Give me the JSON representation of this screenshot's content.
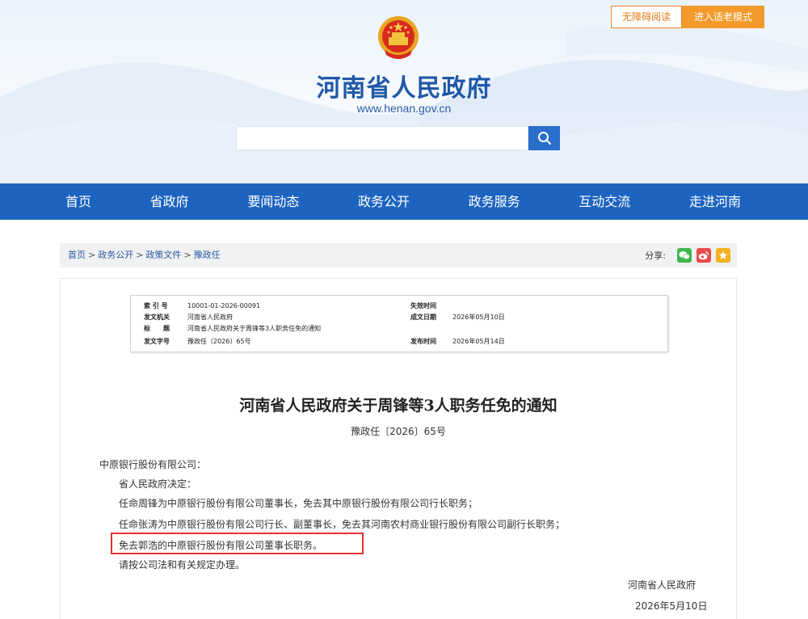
{
  "header": {
    "accessible_label": "无障碍阅读",
    "elder_mode_label": "进入适老模式",
    "site_name": "河南省人民政府",
    "site_url": "www.henan.gov.cn",
    "search_placeholder": ""
  },
  "nav": {
    "items": [
      "首页",
      "省政府",
      "要闻动态",
      "政务公开",
      "政务服务",
      "互动交流",
      "走进河南"
    ]
  },
  "breadcrumb": {
    "items": [
      "首页",
      "政务公开",
      "政策文件",
      "豫政任"
    ],
    "separator": ">"
  },
  "share": {
    "label": "分享:",
    "icons": [
      "wechat-icon",
      "weibo-icon",
      "favorite-icon"
    ]
  },
  "meta": {
    "rows": [
      {
        "k1": "索 引 号",
        "v1": "10001-01-2026-00091",
        "k2": "失效时间",
        "v2": ""
      },
      {
        "k1": "发文机关",
        "v1": "河南省人民政府",
        "k2": "成文日期",
        "v2": "2026年05月10日"
      },
      {
        "k1": "标　　题",
        "v1": "河南省人民政府关于周锋等3人职务任免的通知",
        "k2": "",
        "v2": ""
      },
      {
        "k1": "发文字号",
        "v1": "豫政任〔2026〕65号",
        "k2": "发布时间",
        "v2": "2026年05月14日"
      }
    ]
  },
  "document": {
    "title": "河南省人民政府关于周锋等3人职务任免的通知",
    "number": "豫政任〔2026〕65号",
    "addressee": "中原银行股份有限公司：",
    "paragraphs": [
      "省人民政府决定：",
      "任命周锋为中原银行股份有限公司董事长，免去其中原银行股份有限公司行长职务；",
      "任命张涛为中原银行股份有限公司行长、副董事长，免去其河南农村商业银行股份有限公司副行长职务；",
      "免去郭浩的中原银行股份有限公司董事长职务。",
      "请按公司法和有关规定办理。"
    ],
    "signature": "河南省人民政府",
    "date": "2026年5月10日"
  },
  "colors": {
    "brand_blue": "#1d64c0",
    "accent_orange": "#f39a2b",
    "highlight_red": "#e2342d"
  }
}
